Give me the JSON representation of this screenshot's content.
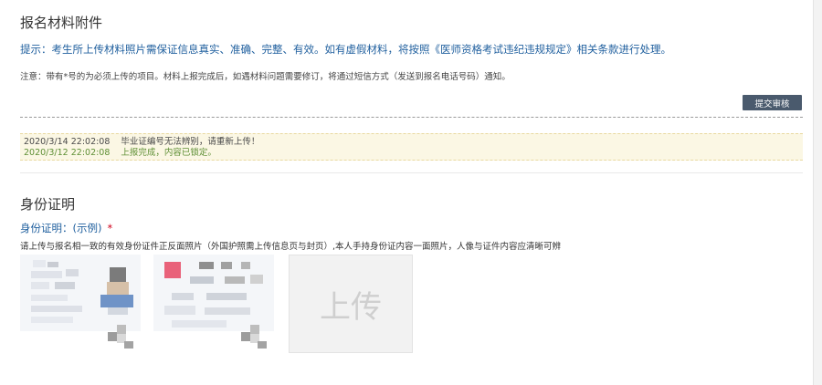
{
  "attachments": {
    "title": "报名材料附件",
    "hint": "提示：考生所上传材料照片需保证信息真实、准确、完整、有效。如有虚假材料，将按照《医师资格考试违纪违规规定》相关条款进行处理。",
    "notice": "注意：带有*号的为必须上传的项目。材料上报完成后，如遇材料问题需要修订，将通过短信方式（发送到报名电话号码）通知。",
    "submit_label": "提交审核"
  },
  "log": [
    {
      "time": "2020/3/14 22:02:08",
      "message": "毕业证编号无法辨别，请重新上传！",
      "status": "warn"
    },
    {
      "time": "2020/3/12 22:02:08",
      "message": "上报完成，内容已锁定。",
      "status": "ok"
    }
  ],
  "identity": {
    "title": "身份证明",
    "label": "身份证明：",
    "example": "(示例)",
    "required_mark": "*",
    "description": "请上传与报名相一致的有效身份证件正反面照片（外国护照需上传信息页与封页）,本人手持身份证内容一面照片，人像与证件内容应清晰可辨",
    "upload_label": "上传"
  },
  "colors": {
    "link_blue": "#1f5f9e",
    "button_bg": "#4a5a6d",
    "ok_green": "#5e8f34",
    "log_bg": "#fbf7e4",
    "required_red": "#d0021b"
  }
}
